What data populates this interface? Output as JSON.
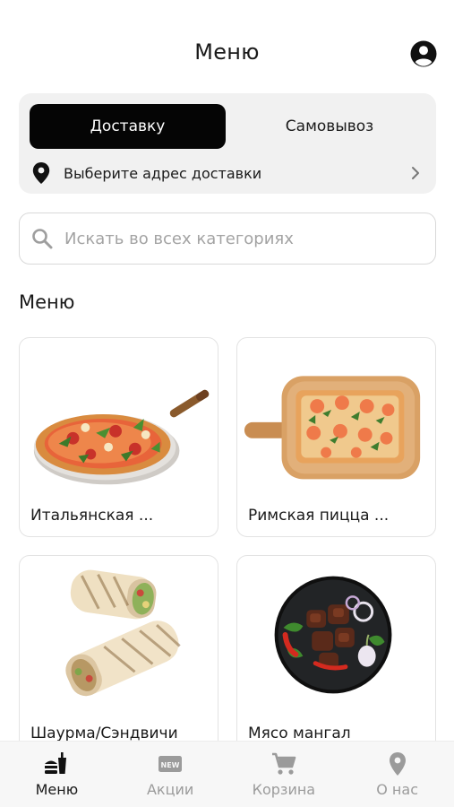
{
  "header": {
    "title": "Меню",
    "profile_icon": "account-circle-icon"
  },
  "delivery": {
    "active_mode": "Доставку",
    "inactive_mode": "Самовывоз",
    "address_prompt": "Выберите адрес доставки",
    "pin_icon": "location-pin-icon",
    "chevron_icon": "chevron-right-icon"
  },
  "search": {
    "placeholder": "Искать во всех категориях",
    "icon": "search-icon"
  },
  "section": {
    "title": "Меню"
  },
  "categories": [
    {
      "label": "Итальянская ...",
      "image": "italian-pizza-photo"
    },
    {
      "label": "Римская пицца ...",
      "image": "roman-pizza-photo"
    },
    {
      "label": "Шаурма/Сэндвичи",
      "image": "shawarma-photo"
    },
    {
      "label": "Мясо мангал",
      "image": "grilled-meat-photo"
    }
  ],
  "nav": {
    "items": [
      {
        "label": "Меню",
        "icon": "fastfood-icon",
        "active": true
      },
      {
        "label": "Акции",
        "icon": "new-badge-icon",
        "active": false
      },
      {
        "label": "Корзина",
        "icon": "cart-icon",
        "active": false
      },
      {
        "label": "О нас",
        "icon": "location-pin-icon",
        "active": false
      }
    ]
  },
  "colors": {
    "accent": "#050505",
    "card_bg": "#f1f1f1",
    "inactive": "#9b9b9b"
  }
}
